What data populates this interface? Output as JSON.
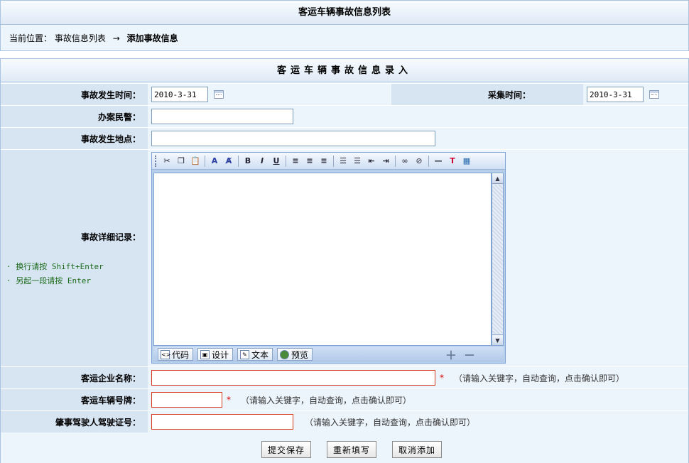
{
  "header": {
    "title": "客运车辆事故信息列表"
  },
  "breadcrumb": {
    "prefix": "当前位置：",
    "parent": "事故信息列表",
    "arrow": "→",
    "current": "添加事故信息"
  },
  "form": {
    "title": "客运车辆事故信息录入",
    "accident_time": {
      "label": "事故发生时间：",
      "value": "2010-3-31"
    },
    "collect_time": {
      "label": "采集时间：",
      "value": "2010-3-31"
    },
    "officer": {
      "label": "办案民警：",
      "value": ""
    },
    "location": {
      "label": "事故发生地点：",
      "value": ""
    },
    "detail": {
      "label": "事故详细记录：",
      "tip1": "· 换行请按 Shift+Enter",
      "tip2": "· 另起一段请按 Enter",
      "modes": {
        "code": "代码",
        "design": "设计",
        "text": "文本",
        "preview": "预览"
      }
    },
    "company": {
      "label": "客运企业名称：",
      "value": "",
      "required": "*",
      "hint": "（请输入关键字，自动查询，点击确认即可）"
    },
    "plate": {
      "label": "客运车辆号牌：",
      "value": "",
      "required": "*",
      "hint": "（请输入关键字，自动查询，点击确认即可）"
    },
    "driver_license": {
      "label": "肇事驾驶人驾驶证号：",
      "value": "",
      "hint": "（请输入关键字，自动查询，点击确认即可）"
    }
  },
  "buttons": {
    "submit": "提交保存",
    "reset": "重新填写",
    "cancel": "取消添加"
  },
  "toolbar_icons": [
    "cut-icon",
    "copy-icon",
    "paste-icon",
    "font-icon",
    "remove-format-icon",
    "bold-icon",
    "italic-icon",
    "underline-icon",
    "align-left-icon",
    "align-center-icon",
    "align-right-icon",
    "ordered-list-icon",
    "unordered-list-icon",
    "outdent-icon",
    "indent-icon",
    "link-icon",
    "unlink-icon",
    "horizontal-rule-icon",
    "text-color-icon",
    "background-color-icon"
  ],
  "colors": {
    "label_bg": "#d7e4f2",
    "field_bg": "#edf5fc",
    "border": "#a9c4e2",
    "required": "#d6381c",
    "tip_text": "#1a6a1a"
  }
}
